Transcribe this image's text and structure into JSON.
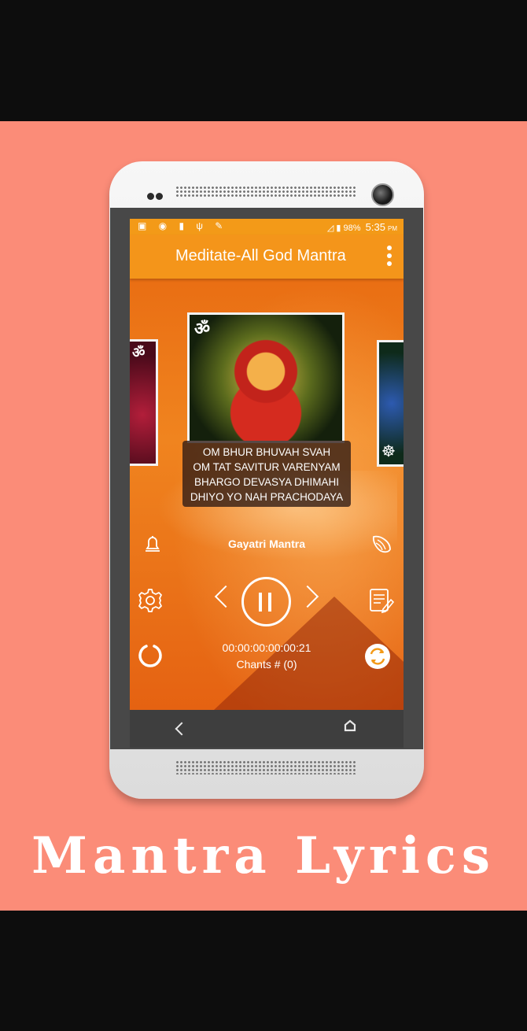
{
  "app": {
    "title": "Meditate-All God Mantra"
  },
  "statusbar": {
    "battery": "98%",
    "time": "5:35",
    "ampm": "PM"
  },
  "lyrics": [
    "OM BHUR BHUVAH SVAH",
    "OM TAT SAVITUR VARENYAM",
    "BHARGO DEVASYA DHIMAHI",
    "DHIYO YO NAH PRACHODAYA"
  ],
  "player": {
    "track_title": "Gayatri Mantra",
    "timer": "00:00:00:00:00:21",
    "chants": "Chants # (0)"
  },
  "card_symbol": "ॐ",
  "caption": "Mantra Lyrics",
  "icons": [
    "bell-icon",
    "conch-icon",
    "gear-icon",
    "notes-icon",
    "replay-icon",
    "shuffle-icon",
    "pause-icon",
    "chevron-left-icon",
    "chevron-right-icon",
    "overflow-menu-icon",
    "back-icon",
    "home-icon"
  ],
  "colors": {
    "promo_background": "#fb8c78",
    "appbar": "#f4951a",
    "statusbar": "#f39a18"
  }
}
